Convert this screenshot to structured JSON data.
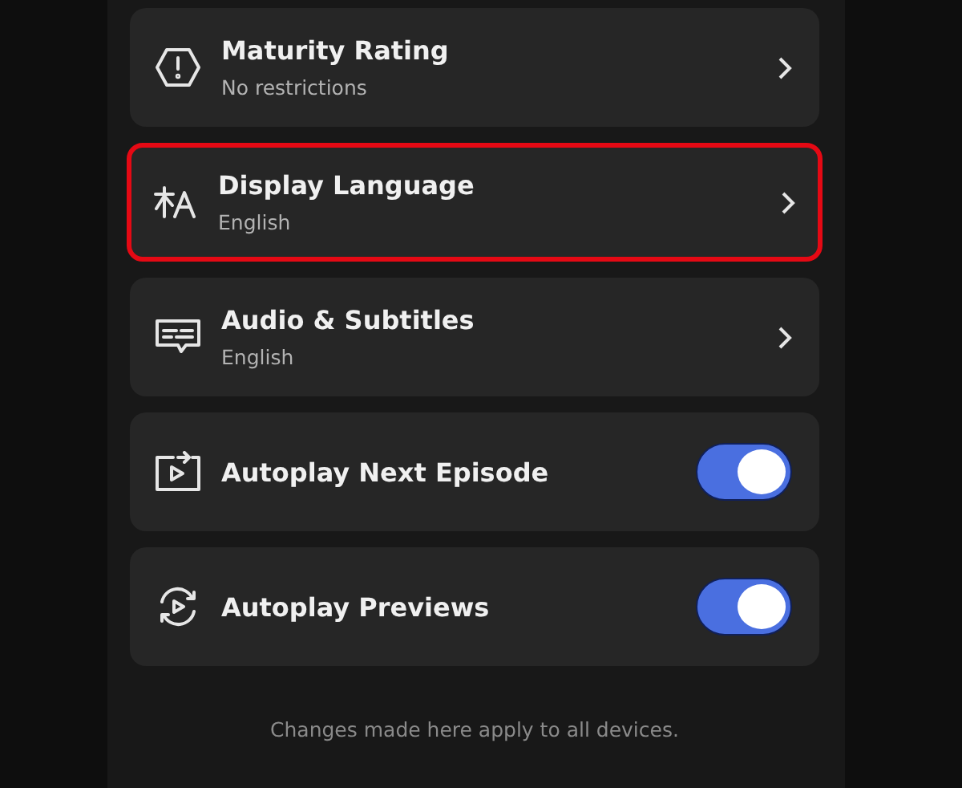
{
  "settings": [
    {
      "kind": "link",
      "title": "Maturity Rating",
      "subtitle": "No restrictions",
      "highlighted": false
    },
    {
      "kind": "link",
      "title": "Display Language",
      "subtitle": "English",
      "highlighted": true
    },
    {
      "kind": "link",
      "title": "Audio & Subtitles",
      "subtitle": "English",
      "highlighted": false
    },
    {
      "kind": "toggle",
      "title": "Autoplay Next Episode",
      "on": true,
      "highlighted": false
    },
    {
      "kind": "toggle",
      "title": "Autoplay Previews",
      "on": true,
      "highlighted": false
    }
  ],
  "footer": "Changes made here apply to all devices."
}
